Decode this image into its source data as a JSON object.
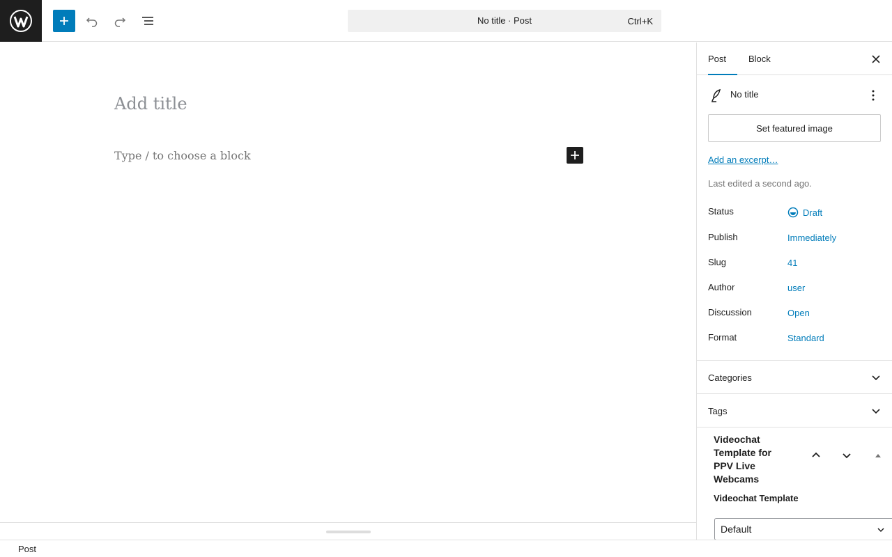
{
  "toolbar": {
    "logo_icon": "wordpress-logo-icon",
    "inserter_icon": "plus-icon",
    "undo_icon": "undo-icon",
    "redo_icon": "redo-icon",
    "list_view_icon": "list-view-icon",
    "command_title": "No title · Post",
    "command_shortcut": "Ctrl+K"
  },
  "editor": {
    "title_placeholder": "Add title",
    "block_placeholder": "Type / to choose a block",
    "block_inserter_icon": "plus-icon"
  },
  "footer": {
    "breadcrumb": "Post"
  },
  "sidebar": {
    "tabs": [
      {
        "label": "Post",
        "active": true
      },
      {
        "label": "Block",
        "active": false
      }
    ],
    "close_icon": "close-icon",
    "post_summary": {
      "title": "No title",
      "featured_image_button": "Set featured image",
      "excerpt_link": "Add an excerpt…",
      "last_edited": "Last edited a second ago.",
      "meta": [
        {
          "label": "Status",
          "value": "Draft"
        },
        {
          "label": "Publish",
          "value": "Immediately"
        },
        {
          "label": "Slug",
          "value": "41"
        },
        {
          "label": "Author",
          "value": "user"
        },
        {
          "label": "Discussion",
          "value": "Open"
        },
        {
          "label": "Format",
          "value": "Standard"
        }
      ]
    },
    "panels": [
      {
        "label": "Categories"
      },
      {
        "label": "Tags"
      }
    ],
    "metabox": {
      "title": "Videochat Template for PPV Live Webcams",
      "field_label": "Videochat Template",
      "selected_value": "Default"
    }
  },
  "colors": {
    "accent": "#007cba",
    "dark": "#1e1e1e",
    "border": "#e0e0e0"
  }
}
